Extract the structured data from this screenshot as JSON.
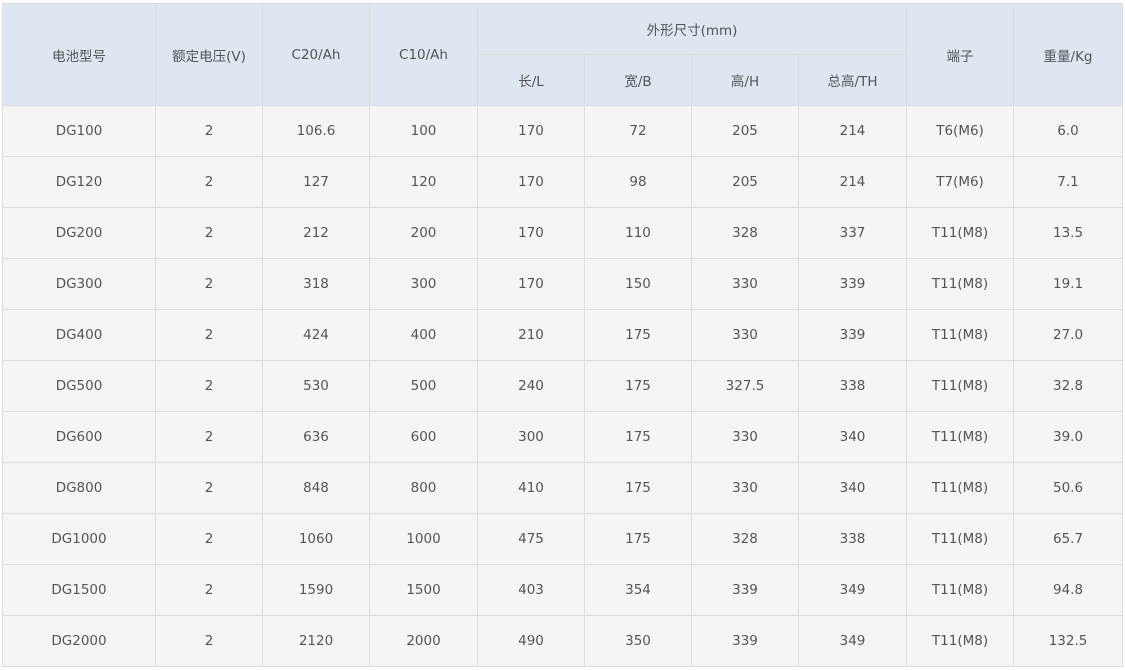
{
  "table": {
    "headers": {
      "model": "电池型号",
      "voltage": "额定电压(V)",
      "c20": "C20/Ah",
      "c10": "C10/Ah",
      "dimensions": "外形尺寸(mm)",
      "length": "长/L",
      "width": "宽/B",
      "height": "高/H",
      "total_height": "总高/TH",
      "terminal": "端子",
      "weight": "重量/Kg"
    },
    "rows": [
      [
        "DG100",
        "2",
        "106.6",
        "100",
        "170",
        "72",
        "205",
        "214",
        "T6(M6)",
        "6.0"
      ],
      [
        "DG120",
        "2",
        "127",
        "120",
        "170",
        "98",
        "205",
        "214",
        "T7(M6)",
        "7.1"
      ],
      [
        "DG200",
        "2",
        "212",
        "200",
        "170",
        "110",
        "328",
        "337",
        "T11(M8)",
        "13.5"
      ],
      [
        "DG300",
        "2",
        "318",
        "300",
        "170",
        "150",
        "330",
        "339",
        "T11(M8)",
        "19.1"
      ],
      [
        "DG400",
        "2",
        "424",
        "400",
        "210",
        "175",
        "330",
        "339",
        "T11(M8)",
        "27.0"
      ],
      [
        "DG500",
        "2",
        "530",
        "500",
        "240",
        "175",
        "327.5",
        "338",
        "T11(M8)",
        "32.8"
      ],
      [
        "DG600",
        "2",
        "636",
        "600",
        "300",
        "175",
        "330",
        "340",
        "T11(M8)",
        "39.0"
      ],
      [
        "DG800",
        "2",
        "848",
        "800",
        "410",
        "175",
        "330",
        "340",
        "T11(M8)",
        "50.6"
      ],
      [
        "DG1000",
        "2",
        "1060",
        "1000",
        "475",
        "175",
        "328",
        "338",
        "T11(M8)",
        "65.7"
      ],
      [
        "DG1500",
        "2",
        "1590",
        "1500",
        "403",
        "354",
        "339",
        "349",
        "T11(M8)",
        "94.8"
      ],
      [
        "DG2000",
        "2",
        "2120",
        "2000",
        "490",
        "350",
        "339",
        "349",
        "T11(M8)",
        "132.5"
      ]
    ]
  },
  "colors": {
    "header_bg": "#dde6f1",
    "row_bg": "#f5f5f5",
    "border": "#dddddd",
    "text": "#555555"
  }
}
